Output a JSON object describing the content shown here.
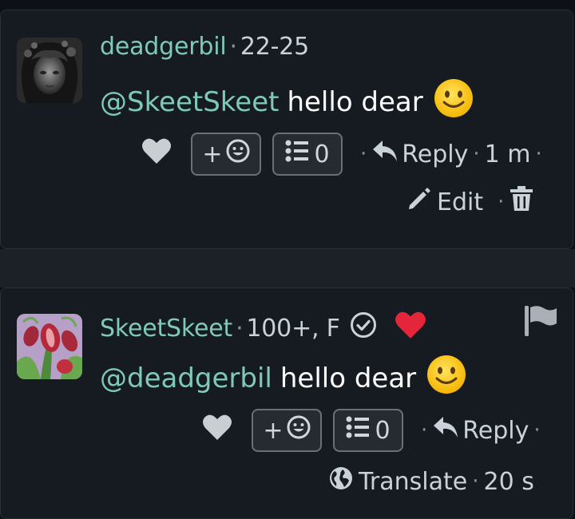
{
  "comments": [
    {
      "username": "deadgerbil",
      "meta": "22-25",
      "mention": "@SkeetSkeet",
      "message": "hello dear",
      "reaction_label": "+",
      "threads_count": "0",
      "reply_label": "Reply",
      "time": "1 m",
      "edit_label": "Edit"
    },
    {
      "username": "SkeetSkeet",
      "meta": "100+, F",
      "mention": "@deadgerbil",
      "message": "hello dear",
      "reaction_label": "+",
      "threads_count": "0",
      "reply_label": "Reply",
      "translate_label": "Translate",
      "time": "20 s"
    }
  ],
  "icons": {
    "like": "heart-icon",
    "add_reaction": "smiley-icon",
    "threads": "list-icon",
    "reply": "reply-arrow-icon",
    "edit": "pencil-icon",
    "delete": "trash-icon",
    "verified": "check-circle-icon",
    "liked": "heart-filled-icon",
    "report": "flag-icon",
    "translate": "globe-icon"
  },
  "colors": {
    "username": "#7ec9b8",
    "background": "#0d1117",
    "card": "#161b22",
    "liked_heart": "#e5263a"
  }
}
